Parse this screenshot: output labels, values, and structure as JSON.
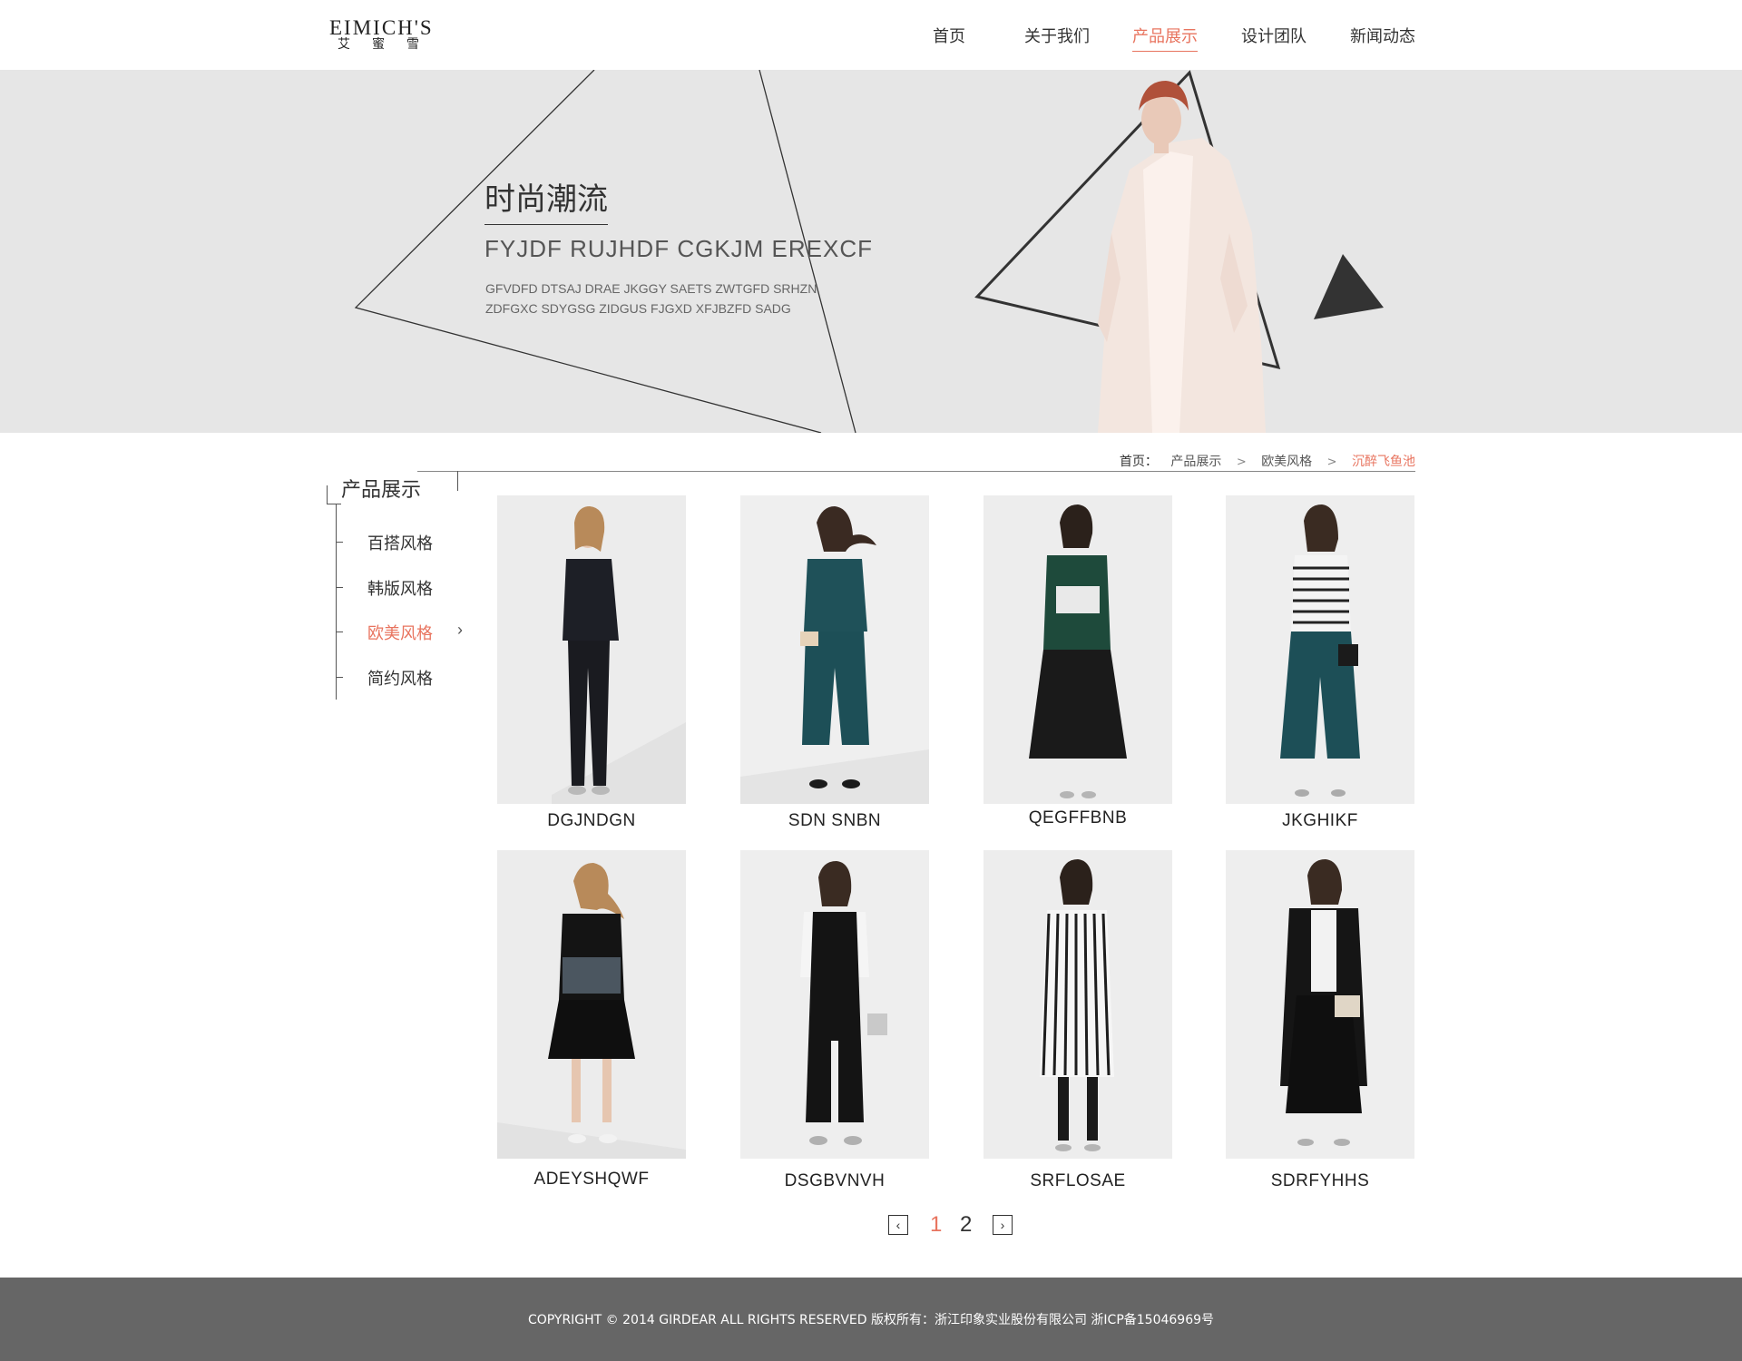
{
  "header": {
    "logo_en": "EIMICH'S",
    "logo_cn": "艾蜜雪",
    "nav": [
      {
        "label": "首页"
      },
      {
        "label": "关于我们"
      },
      {
        "label": "产品展示"
      },
      {
        "label": "设计团队"
      },
      {
        "label": "新闻动态"
      }
    ],
    "active_nav": "产品展示"
  },
  "banner": {
    "title": "时尚潮流",
    "subtitle": "FYJDF RUJHDF CGKJM EREXCF",
    "desc_line1": "GFVDFD DTSAJ DRAE JKGGY SAETS ZWTGFD SRHZN",
    "desc_line2": "ZDFGXC SDYGSG ZIDGUS FJGXD XFJBZFD SADG"
  },
  "breadcrumb": {
    "label": "首页：",
    "items": [
      "产品展示",
      "欧美风格"
    ],
    "current": "沉醉飞鱼池"
  },
  "sidebar": {
    "title": "产品展示",
    "items": [
      {
        "label": "百搭风格"
      },
      {
        "label": "韩版风格"
      },
      {
        "label": "欧美风格"
      },
      {
        "label": "简约风格"
      }
    ],
    "active_item": "欧美风格"
  },
  "products": [
    {
      "name": "DGJNDGN"
    },
    {
      "name": "SDN SNBN"
    },
    {
      "name": "QEGFFBNB"
    },
    {
      "name": "JKGHIKF"
    },
    {
      "name": "ADEYSHQWF"
    },
    {
      "name": "DSGBVNVH"
    },
    {
      "name": "SRFLOSAE"
    },
    {
      "name": "SDRFYHHS"
    }
  ],
  "pagination": {
    "prev_icon": "chevron-left-icon",
    "next_icon": "chevron-right-icon",
    "pages": [
      "1",
      "2"
    ],
    "current": "1"
  },
  "footer": {
    "text": "COPYRIGHT © 2014 GIRDEAR ALL RIGHTS RESERVED 版权所有：浙江印象实业股份有限公司  浙ICP备15046969号"
  },
  "colors": {
    "accent": "#e8745f",
    "banner_bg": "#e6e6e6",
    "footer_bg": "#666666"
  }
}
